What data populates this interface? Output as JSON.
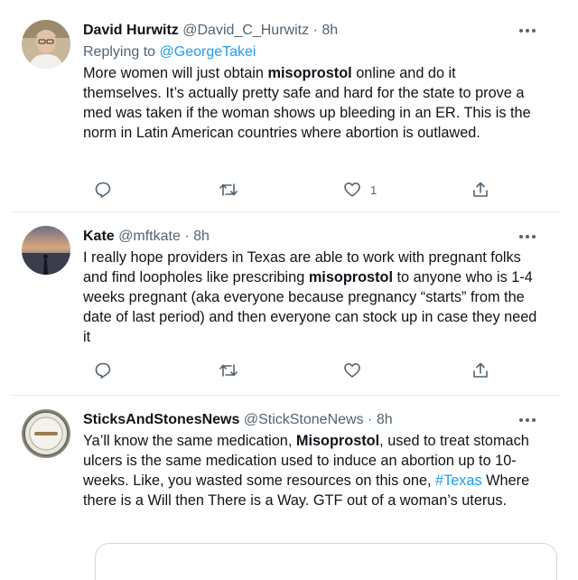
{
  "colors": {
    "link": "#1d9bf0",
    "muted": "#536471",
    "text": "#0f1419",
    "divider": "#e6ecf0"
  },
  "tweets": [
    {
      "name": "David Hurwitz",
      "handle": "@David_C_Hurwitz",
      "dot": "·",
      "time": "8h",
      "reply_prefix": "Replying to",
      "reply_to": "@GeorgeTakei",
      "text_parts": [
        "More women will just obtain ",
        "misoprostol",
        " online and do it themselves. It’s actually pretty safe and hard for the state to prove a med was taken if the woman shows up bleeding in an ER. This is the norm in Latin American countries where abortion is outlawed."
      ],
      "like_count": "1",
      "icons": [
        "reply-icon",
        "retweet-icon",
        "like-icon",
        "share-icon",
        "more-icon"
      ]
    },
    {
      "name": "Kate",
      "handle": "@mftkate",
      "dot": "·",
      "time": "8h",
      "text_parts": [
        "I really hope providers in Texas are able to work with pregnant folks and find loopholes like prescribing ",
        "misoprostol",
        " to anyone who is 1-4 weeks pregnant (aka everyone because pregnancy “starts” from the date of last period) and then everyone can stock up in case they need it"
      ],
      "like_count": "",
      "icons": [
        "reply-icon",
        "retweet-icon",
        "like-icon",
        "share-icon",
        "more-icon"
      ]
    },
    {
      "name": "SticksAndStonesNews",
      "handle": "@StickStoneNews",
      "dot": "·",
      "time": "8h",
      "text_parts": [
        "Ya’ll know the same medication, ",
        "Misoprostol",
        ",  used to treat stomach ulcers is the same medication used to induce an abortion up to 10-weeks. Like, you wasted some resources on this one, ",
        "#Texas",
        " Where there is a Will then There is a Way. GTF out of a woman’s uterus."
      ],
      "icons": [
        "more-icon"
      ]
    }
  ]
}
